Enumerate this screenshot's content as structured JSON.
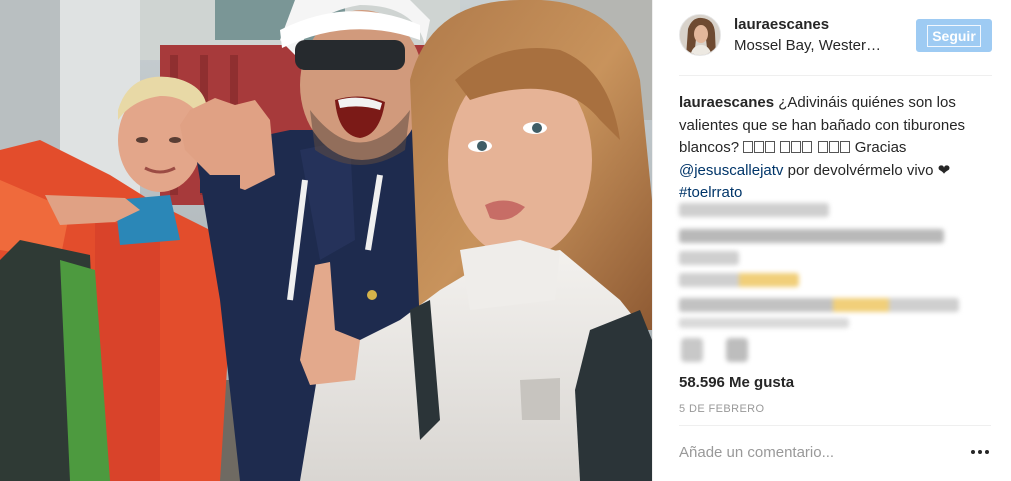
{
  "post": {
    "username": "lauraescanes",
    "location": "Mossel Bay, Wester…",
    "follow_label": "Seguir",
    "caption": {
      "username": "lauraescanes",
      "text_1": "¿Adivináis quiénes son los valientes que se han bañado con tiburones blancos?",
      "text_2": "Gracias",
      "mention": "@jesuscallejatv",
      "text_3": "por devolvérmelo vivo ❤",
      "hashtag": "#toelrrato"
    },
    "likes": "58.596 Me gusta",
    "date": "5 DE FEBRERO",
    "comment_placeholder": "Añade un comentario...",
    "icons": {
      "more": "more-options-icon",
      "emoji": "emoji-placeholder-icon"
    },
    "colors": {
      "follow_button": "#9ecbf3",
      "link": "#003569",
      "text": "#262626",
      "muted": "#999999"
    }
  }
}
